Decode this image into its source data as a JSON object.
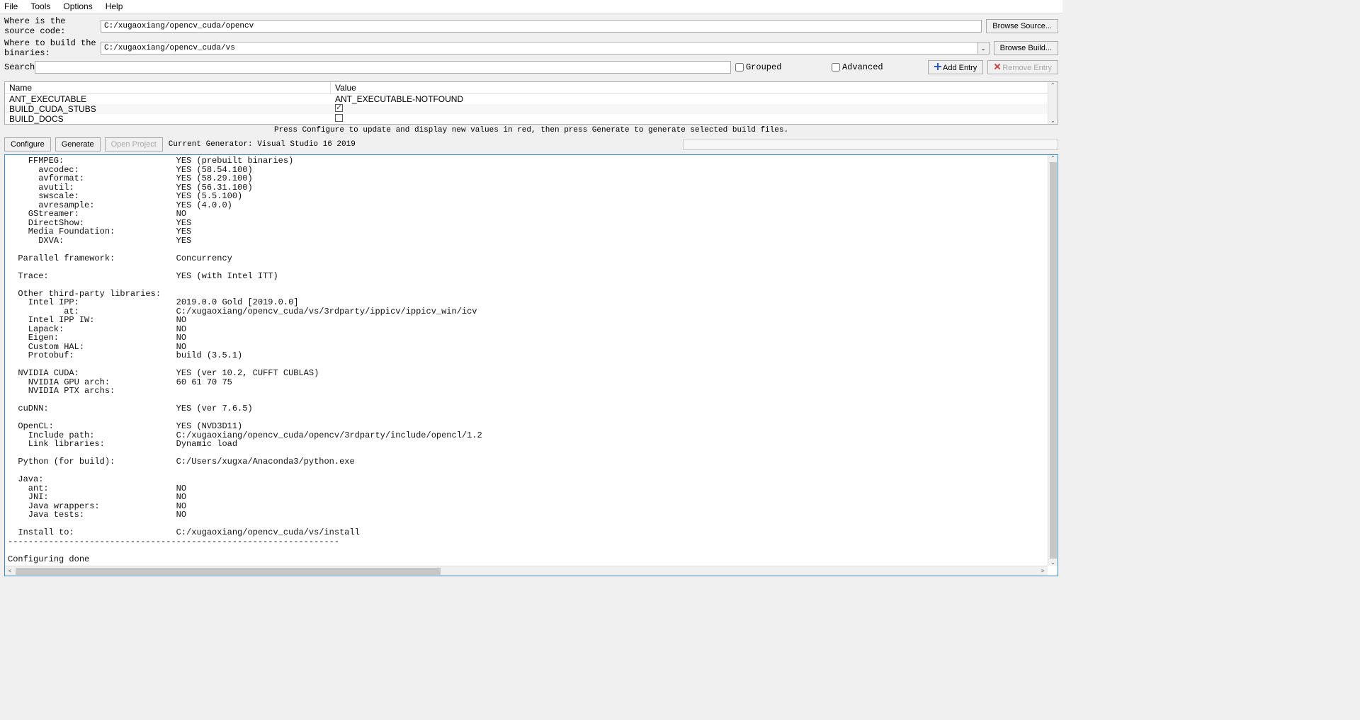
{
  "menu": {
    "file": "File",
    "tools": "Tools",
    "options": "Options",
    "help": "Help"
  },
  "form": {
    "source_label": "Where is the source code:",
    "source_value": "C:/xugaoxiang/opencv_cuda/opencv",
    "browse_source": "Browse Source...",
    "build_label": "Where to build the binaries:",
    "build_value": "C:/xugaoxiang/opencv_cuda/vs",
    "browse_build": "Browse Build...",
    "search_label": "Search:",
    "search_value": "",
    "grouped": "Grouped",
    "advanced": "Advanced",
    "add_entry": "Add Entry",
    "remove_entry": "Remove Entry"
  },
  "table": {
    "col_name": "Name",
    "col_value": "Value",
    "rows": [
      {
        "name": "ANT_EXECUTABLE",
        "value_text": "ANT_EXECUTABLE-NOTFOUND"
      },
      {
        "name": "BUILD_CUDA_STUBS",
        "checkbox": true,
        "checked": true
      },
      {
        "name": "BUILD_DOCS",
        "checkbox": true,
        "checked": false
      }
    ]
  },
  "hint": "Press Configure to update and display new values in red, then press Generate to generate selected build files.",
  "actions": {
    "configure": "Configure",
    "generate": "Generate",
    "open_project": "Open Project",
    "current_generator": "Current Generator: Visual Studio 16 2019"
  },
  "output": "    FFMPEG:                      YES (prebuilt binaries)\n      avcodec:                   YES (58.54.100)\n      avformat:                  YES (58.29.100)\n      avutil:                    YES (56.31.100)\n      swscale:                   YES (5.5.100)\n      avresample:                YES (4.0.0)\n    GStreamer:                   NO\n    DirectShow:                  YES\n    Media Foundation:            YES\n      DXVA:                      YES\n\n  Parallel framework:            Concurrency\n\n  Trace:                         YES (with Intel ITT)\n\n  Other third-party libraries:\n    Intel IPP:                   2019.0.0 Gold [2019.0.0]\n           at:                   C:/xugaoxiang/opencv_cuda/vs/3rdparty/ippicv/ippicv_win/icv\n    Intel IPP IW:                NO\n    Lapack:                      NO\n    Eigen:                       NO\n    Custom HAL:                  NO\n    Protobuf:                    build (3.5.1)\n\n  NVIDIA CUDA:                   YES (ver 10.2, CUFFT CUBLAS)\n    NVIDIA GPU arch:             60 61 70 75\n    NVIDIA PTX archs:\n\n  cuDNN:                         YES (ver 7.6.5)\n\n  OpenCL:                        YES (NVD3D11)\n    Include path:                C:/xugaoxiang/opencv_cuda/opencv/3rdparty/include/opencl/1.2\n    Link libraries:              Dynamic load\n\n  Python (for build):            C:/Users/xugxa/Anaconda3/python.exe\n\n  Java:\n    ant:                         NO\n    JNI:                         NO\n    Java wrappers:               NO\n    Java tests:                  NO\n\n  Install to:                    C:/xugaoxiang/opencv_cuda/vs/install\n-----------------------------------------------------------------\n\nConfiguring done"
}
